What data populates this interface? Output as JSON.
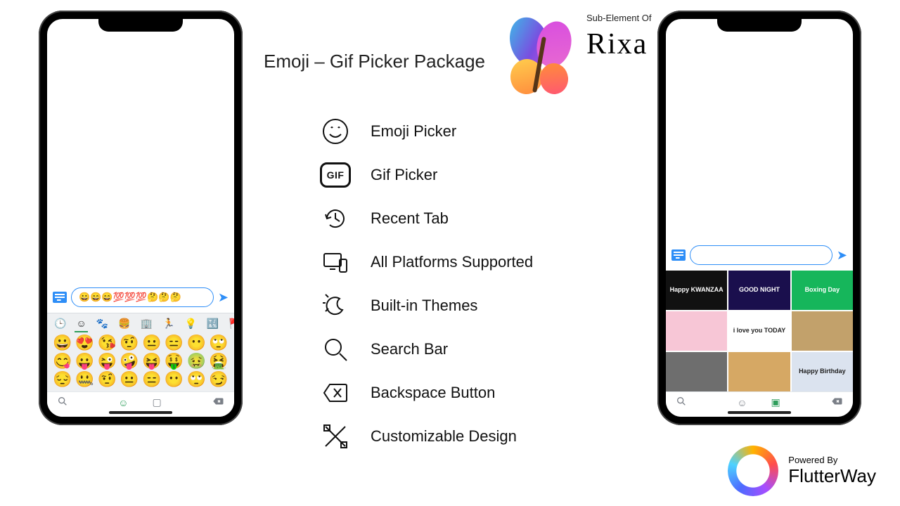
{
  "headline": "Emoji – Gif Picker Package",
  "rixa": {
    "sub": "Sub-Element Of",
    "name": "Rixa"
  },
  "flutterway": {
    "powered": "Powered By",
    "name": "FlutterWay"
  },
  "features": [
    {
      "label": "Emoji Picker"
    },
    {
      "label": "Gif Picker"
    },
    {
      "label": "Recent Tab"
    },
    {
      "label": "All Platforms Supported"
    },
    {
      "label": "Built-in Themes"
    },
    {
      "label": "Search Bar"
    },
    {
      "label": "Backspace Button"
    },
    {
      "label": "Customizable Design"
    }
  ],
  "phoneLeft": {
    "input_value": "😀😄😄💯💯💯🤔🤔🤔",
    "categories": [
      "🕒",
      "☺",
      "🐾",
      "🍔",
      "🏢",
      "🏃",
      "💡",
      "🔣",
      "🚩"
    ],
    "emoji_rows": [
      [
        "😀",
        "😍",
        "😘",
        "🤨",
        "😐",
        "😑",
        "😶",
        "🙄"
      ],
      [
        "😋",
        "😛",
        "😜",
        "🤪",
        "😝",
        "🤑",
        "🤢",
        "🤮"
      ],
      [
        "😔",
        "🤐",
        "🤨",
        "😐",
        "😑",
        "😶",
        "🙄",
        "😏"
      ]
    ]
  },
  "phoneRight": {
    "input_value": "",
    "gifs": [
      {
        "label": "Happy KWANZAA"
      },
      {
        "label": "GOOD NIGHT"
      },
      {
        "label": "Boxing Day"
      },
      {
        "label": ""
      },
      {
        "label": "i love you TODAY"
      },
      {
        "label": ""
      },
      {
        "label": ""
      },
      {
        "label": ""
      },
      {
        "label": "Happy Birthday"
      }
    ]
  }
}
